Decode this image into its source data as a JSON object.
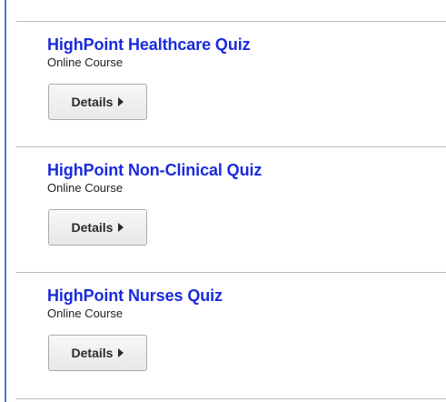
{
  "courses": [
    {
      "title": "HighPoint Healthcare Quiz",
      "type": "Online Course",
      "button_label": "Details"
    },
    {
      "title": "HighPoint Non-Clinical Quiz",
      "type": "Online Course",
      "button_label": "Details"
    },
    {
      "title": "HighPoint Nurses Quiz",
      "type": "Online Course",
      "button_label": "Details"
    }
  ],
  "colors": {
    "title_link": "#1a2bdc",
    "frame_border": "#4a7fc1",
    "divider": "#b8b8b8"
  },
  "icons": {
    "button_icon": "caret-right-icon"
  }
}
